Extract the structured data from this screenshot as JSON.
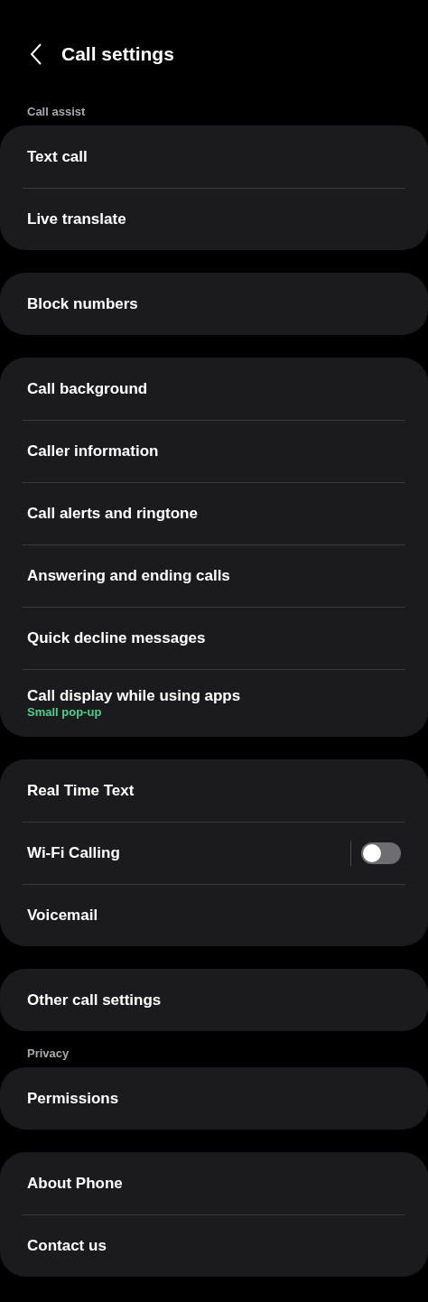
{
  "header": {
    "title": "Call settings"
  },
  "groups": [
    {
      "header": "Call assist",
      "items": [
        {
          "kind": "link",
          "label": "Text call"
        },
        {
          "kind": "link",
          "label": "Live translate"
        }
      ]
    },
    {
      "items": [
        {
          "kind": "link",
          "label": "Block numbers"
        }
      ]
    },
    {
      "items": [
        {
          "kind": "link",
          "label": "Call background"
        },
        {
          "kind": "link",
          "label": "Caller information"
        },
        {
          "kind": "link",
          "label": "Call alerts and ringtone"
        },
        {
          "kind": "link",
          "label": "Answering and ending calls"
        },
        {
          "kind": "link",
          "label": "Quick decline messages"
        },
        {
          "kind": "link",
          "label": "Call display while using apps",
          "subtitle": "Small pop-up"
        }
      ]
    },
    {
      "items": [
        {
          "kind": "link",
          "label": "Real Time Text"
        },
        {
          "kind": "switch",
          "label": "Wi-Fi Calling",
          "on": false
        },
        {
          "kind": "link",
          "label": "Voicemail"
        }
      ]
    },
    {
      "items": [
        {
          "kind": "link",
          "label": "Other call settings"
        }
      ]
    },
    {
      "header": "Privacy",
      "items": [
        {
          "kind": "link",
          "label": "Permissions"
        }
      ]
    },
    {
      "items": [
        {
          "kind": "link",
          "label": "About Phone"
        },
        {
          "kind": "link",
          "label": "Contact us"
        }
      ]
    }
  ]
}
